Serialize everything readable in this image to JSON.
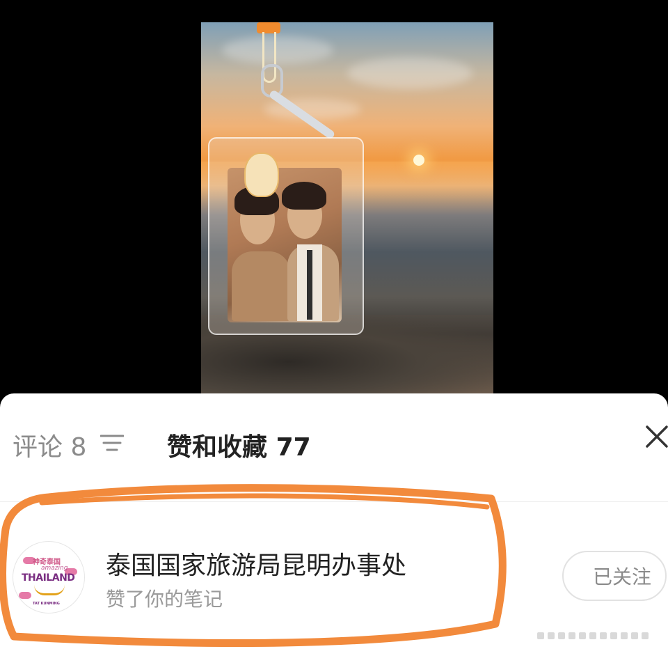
{
  "tabs": {
    "comments_label": "评论",
    "comments_count": "8",
    "likes_label": "赞和收藏",
    "likes_count": "77"
  },
  "notification": {
    "user_name": "泰国国家旅游局昆明办事处",
    "action": "赞了你的笔记",
    "follow_label": "已关注"
  },
  "avatar_logo": {
    "cn": "神奇泰国",
    "amazing": "amazing",
    "thailand": "THAILAND",
    "sub": "TAT KUNMING"
  },
  "icons": {
    "sort": "sort-lines-icon",
    "close": "close-icon"
  },
  "colors": {
    "annotation": "#f28a3c",
    "panel_bg": "#ffffff",
    "text_primary": "#222222",
    "text_secondary": "#9a9a9a"
  }
}
